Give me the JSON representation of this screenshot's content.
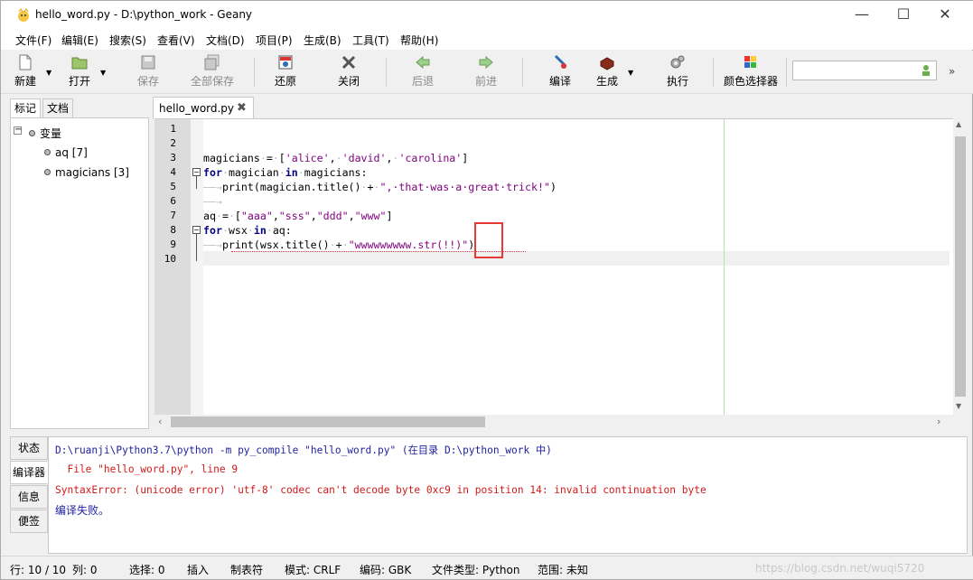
{
  "window": {
    "title": "hello_word.py - D:\\python_work - Geany",
    "minimize": "—",
    "maximize": "☐",
    "close": "✕"
  },
  "menu": [
    "文件(F)",
    "编辑(E)",
    "搜索(S)",
    "查看(V)",
    "文档(D)",
    "项目(P)",
    "生成(B)",
    "工具(T)",
    "帮助(H)"
  ],
  "toolbar": {
    "new": "新建",
    "open": "打开",
    "save": "保存",
    "save_all": "全部保存",
    "revert": "还原",
    "close": "关闭",
    "back": "后退",
    "forward": "前进",
    "compile": "编译",
    "build": "生成",
    "execute": "执行",
    "color": "颜色选择器",
    "more": "»"
  },
  "sidebar": {
    "tabs": [
      "标记",
      "文档"
    ],
    "root": "变量",
    "items": [
      "aq [7]",
      "magicians [3]"
    ]
  },
  "editor": {
    "tab": "hello_word.py",
    "line_numbers": [
      "1",
      "2",
      "3",
      "4",
      "5",
      "6",
      "7",
      "8",
      "9",
      "10"
    ]
  },
  "messages": {
    "tabs": [
      "状态",
      "编译器",
      "信息",
      "便签"
    ],
    "lines": [
      "D:\\ruanji\\Python3.7\\python -m py_compile \"hello_word.py\" (在目录 D:\\python_work 中)",
      "  File \"hello_word.py\", line 9",
      "SyntaxError: (unicode error) 'utf-8' codec can't decode byte 0xc9 in position 14: invalid continuation byte",
      "编译失败。"
    ]
  },
  "status": {
    "pos": "行: 10 / 10",
    "col": "列: 0",
    "sel": "选择: 0",
    "ins": "插入",
    "tab": "制表符",
    "mode": "模式: CRLF",
    "enc": "编码: GBK",
    "ftype": "文件类型: Python",
    "scope": "范围: 未知"
  },
  "watermark": "https://blog.csdn.net/wuqi5720"
}
